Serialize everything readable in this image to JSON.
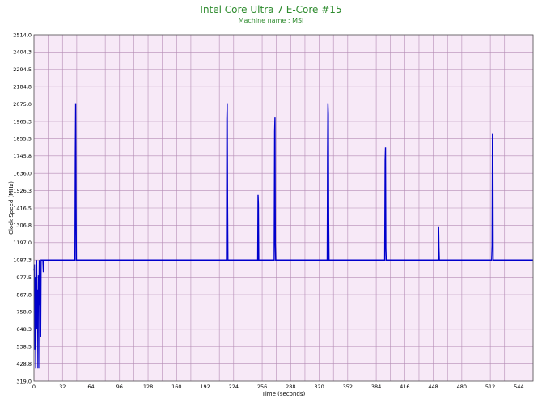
{
  "chart_data": {
    "type": "line",
    "title": "Intel Core Ultra 7 E-Core #15",
    "subtitle": "Machine name : MSI",
    "xlabel": "Time (seconds)",
    "ylabel": "Clock Speed (MHz)",
    "xlim": [
      0,
      560
    ],
    "ylim": [
      319.0,
      2514.0
    ],
    "x_ticks": [
      "0",
      "32",
      "64",
      "96",
      "128",
      "160",
      "192",
      "224",
      "256",
      "288",
      "320",
      "352",
      "384",
      "416",
      "448",
      "480",
      "512",
      "544"
    ],
    "y_ticks": [
      "319.0",
      "428.8",
      "538.5",
      "648.3",
      "758.0",
      "867.8",
      "977.5",
      "1087.3",
      "1197.0",
      "1306.8",
      "1416.5",
      "1526.3",
      "1636.0",
      "1745.8",
      "1855.5",
      "1965.3",
      "2075.0",
      "2184.8",
      "2294.5",
      "2404.3",
      "2514.0"
    ],
    "grid": true,
    "background": "#f7e9f7",
    "grid_color": "#b58cb5",
    "line_color": "#0000cc",
    "series": [
      {
        "values": [
          [
            0,
            1020
          ],
          [
            0.5,
            1060
          ],
          [
            1,
            520
          ],
          [
            1.5,
            980
          ],
          [
            2,
            400
          ],
          [
            2.5,
            1040
          ],
          [
            3,
            1087
          ],
          [
            3.5,
            650
          ],
          [
            4,
            900
          ],
          [
            4.5,
            400
          ],
          [
            5,
            990
          ],
          [
            5.5,
            800
          ],
          [
            6,
            1087
          ],
          [
            6.5,
            400
          ],
          [
            7,
            1000
          ],
          [
            7.5,
            600
          ],
          [
            8,
            1087
          ],
          [
            10,
            1087
          ],
          [
            10.5,
            1010
          ],
          [
            11,
            1087
          ],
          [
            46,
            1087
          ],
          [
            46.4,
            1740
          ],
          [
            46.8,
            2080
          ],
          [
            47.2,
            1450
          ],
          [
            47.6,
            1087
          ],
          [
            216,
            1087
          ],
          [
            216.4,
            1980
          ],
          [
            216.8,
            2080
          ],
          [
            217.2,
            1450
          ],
          [
            217.6,
            1087
          ],
          [
            251,
            1087
          ],
          [
            251.4,
            1500
          ],
          [
            251.8,
            1440
          ],
          [
            252.2,
            1087
          ],
          [
            269.5,
            1087
          ],
          [
            270,
            1900
          ],
          [
            270.4,
            1990
          ],
          [
            270.8,
            1190
          ],
          [
            271.2,
            1087
          ],
          [
            329,
            1087
          ],
          [
            329.4,
            1760
          ],
          [
            329.8,
            2080
          ],
          [
            330.2,
            2010
          ],
          [
            330.6,
            1350
          ],
          [
            331,
            1087
          ],
          [
            393.5,
            1087
          ],
          [
            394,
            1720
          ],
          [
            394.4,
            1800
          ],
          [
            394.8,
            1160
          ],
          [
            395.2,
            1087
          ],
          [
            453.5,
            1087
          ],
          [
            454,
            1300
          ],
          [
            454.4,
            1160
          ],
          [
            454.8,
            1087
          ],
          [
            513.5,
            1087
          ],
          [
            514,
            1180
          ],
          [
            514.4,
            1890
          ],
          [
            514.8,
            1870
          ],
          [
            515.2,
            1087
          ],
          [
            560,
            1087
          ]
        ]
      }
    ]
  }
}
